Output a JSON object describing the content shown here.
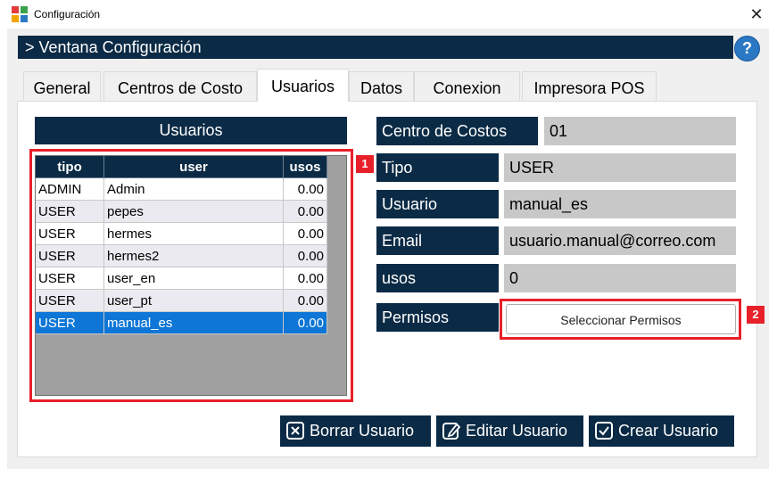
{
  "window": {
    "title": "Configuración",
    "close_glyph": "✕"
  },
  "header": {
    "title": "> Ventana Configuración",
    "help_glyph": "?"
  },
  "tabs": [
    {
      "label": "General"
    },
    {
      "label": "Centros de Costo"
    },
    {
      "label": "Usuarios",
      "active": true
    },
    {
      "label": "Datos"
    },
    {
      "label": "Conexion"
    },
    {
      "label": "Impresora POS"
    }
  ],
  "users_panel": {
    "title": "Usuarios",
    "columns": [
      "tipo",
      "user",
      "usos"
    ],
    "rows": [
      {
        "tipo": "ADMIN",
        "user": "Admin",
        "usos": "0.00"
      },
      {
        "tipo": "USER",
        "user": "pepes",
        "usos": "0.00"
      },
      {
        "tipo": "USER",
        "user": "hermes",
        "usos": "0.00"
      },
      {
        "tipo": "USER",
        "user": "hermes2",
        "usos": "0.00"
      },
      {
        "tipo": "USER",
        "user": "user_en",
        "usos": "0.00"
      },
      {
        "tipo": "USER",
        "user": "user_pt",
        "usos": "0.00"
      },
      {
        "tipo": "USER",
        "user": "manual_es",
        "usos": "0.00",
        "selected": true
      }
    ]
  },
  "form": {
    "centro_label": "Centro de Costos",
    "centro_value": "01",
    "tipo_label": "Tipo",
    "tipo_value": "USER",
    "usuario_label": "Usuario",
    "usuario_value": "manual_es",
    "email_label": "Email",
    "email_value": "usuario.manual@correo.com",
    "usos_label": "usos",
    "usos_value": "0",
    "permisos_label": "Permisos",
    "permisos_button": "Seleccionar Permisos"
  },
  "annotations": {
    "badge1": "1",
    "badge2": "2",
    "color": "#e8202a"
  },
  "actions": {
    "delete": "Borrar Usuario",
    "edit": "Editar Usuario",
    "create": "Crear Usuario"
  },
  "colors": {
    "navy": "#0b2a45",
    "selection": "#0d76d6",
    "field_bg": "#c8c8c8"
  },
  "icons": {
    "app": "app-logo-icon",
    "close": "close-icon",
    "help": "help-icon",
    "delete": "delete-x-icon",
    "edit": "edit-pencil-icon",
    "create": "check-icon"
  }
}
